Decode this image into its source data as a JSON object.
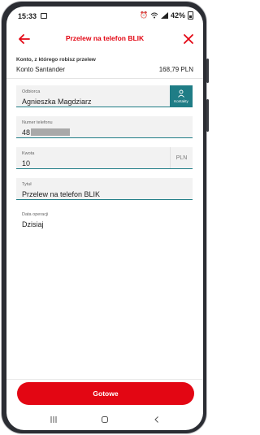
{
  "status_bar": {
    "time": "15:33",
    "battery": "42%",
    "icons": [
      "image-icon",
      "alarm-icon",
      "wifi-icon",
      "signal-icon",
      "battery-icon"
    ]
  },
  "header": {
    "title": "Przelew na telefon BLIK",
    "back_icon": "arrow-left-icon",
    "close_icon": "close-icon",
    "accent_color": "#e30613"
  },
  "account": {
    "label": "Konto, z którego robisz przelew",
    "name": "Konto Santander",
    "balance": "168,79 PLN"
  },
  "form": {
    "recipient": {
      "label": "Odbiorca",
      "value": "Agnieszka Magdziarz",
      "contacts_label": "Kontakty",
      "contacts_color": "#1f7d86"
    },
    "phone": {
      "label": "Numer telefonu",
      "value": "48"
    },
    "amount": {
      "label": "Kwota",
      "value": "10",
      "currency": "PLN"
    },
    "title": {
      "label": "Tytuł",
      "value": "Przelew na telefon BLIK"
    },
    "date": {
      "label": "Data operacji",
      "value": "Dzisiaj"
    }
  },
  "footer": {
    "done_label": "Gotowe"
  },
  "nav": {
    "icons": [
      "recent-apps-icon",
      "home-icon",
      "back-icon"
    ]
  }
}
